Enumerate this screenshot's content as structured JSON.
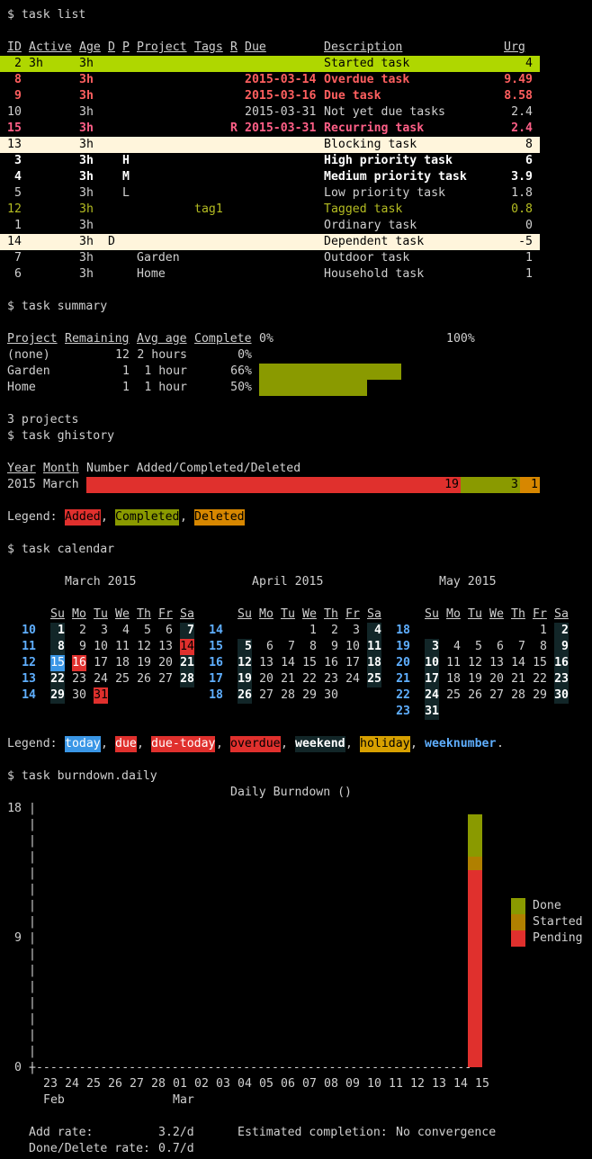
{
  "commands": {
    "list": "$ task list",
    "summary": "$ task summary",
    "ghistory": "$ task ghistory",
    "calendar": "$ task calendar",
    "burndown": "$ task burndown.daily"
  },
  "task_list": {
    "headers": [
      "ID",
      "Active",
      "Age",
      "D",
      "P",
      "Project",
      "Tags",
      "R",
      "Due",
      "Description",
      "Urg"
    ],
    "rows": [
      {
        "id": "2",
        "active": "3h",
        "age": "3h",
        "d": "",
        "p": "",
        "project": "",
        "tags": "",
        "r": "",
        "due": "",
        "desc": "Started task",
        "urg": "4",
        "style": "started"
      },
      {
        "id": "8",
        "active": "",
        "age": "3h",
        "d": "",
        "p": "",
        "project": "",
        "tags": "",
        "r": "",
        "due": "2015-03-14",
        "desc": "Overdue task",
        "urg": "9.49",
        "style": "overdue"
      },
      {
        "id": "9",
        "active": "",
        "age": "3h",
        "d": "",
        "p": "",
        "project": "",
        "tags": "",
        "r": "",
        "due": "2015-03-16",
        "desc": "Due task",
        "urg": "8.58",
        "style": "due"
      },
      {
        "id": "10",
        "active": "",
        "age": "3h",
        "d": "",
        "p": "",
        "project": "",
        "tags": "",
        "r": "",
        "due": "2015-03-31",
        "desc": "Not yet due tasks",
        "urg": "2.4",
        "style": "normal"
      },
      {
        "id": "15",
        "active": "",
        "age": "3h",
        "d": "",
        "p": "",
        "project": "",
        "tags": "",
        "r": "R",
        "due": "2015-03-31",
        "desc": "Recurring task",
        "urg": "2.4",
        "style": "recurring"
      },
      {
        "id": "13",
        "active": "",
        "age": "3h",
        "d": "",
        "p": "",
        "project": "",
        "tags": "",
        "r": "",
        "due": "",
        "desc": "Blocking task",
        "urg": "8",
        "style": "blocking"
      },
      {
        "id": "3",
        "active": "",
        "age": "3h",
        "d": "",
        "p": "H",
        "project": "",
        "tags": "",
        "r": "",
        "due": "",
        "desc": "High priority task",
        "urg": "6",
        "style": "high"
      },
      {
        "id": "4",
        "active": "",
        "age": "3h",
        "d": "",
        "p": "M",
        "project": "",
        "tags": "",
        "r": "",
        "due": "",
        "desc": "Medium priority task",
        "urg": "3.9",
        "style": "medium"
      },
      {
        "id": "5",
        "active": "",
        "age": "3h",
        "d": "",
        "p": "L",
        "project": "",
        "tags": "",
        "r": "",
        "due": "",
        "desc": "Low priority task",
        "urg": "1.8",
        "style": "normal"
      },
      {
        "id": "12",
        "active": "",
        "age": "3h",
        "d": "",
        "p": "",
        "project": "",
        "tags": "tag1",
        "r": "",
        "due": "",
        "desc": "Tagged task",
        "urg": "0.8",
        "style": "tagged"
      },
      {
        "id": "1",
        "active": "",
        "age": "3h",
        "d": "",
        "p": "",
        "project": "",
        "tags": "",
        "r": "",
        "due": "",
        "desc": "Ordinary task",
        "urg": "0",
        "style": "normal"
      },
      {
        "id": "14",
        "active": "",
        "age": "3h",
        "d": "D",
        "p": "",
        "project": "",
        "tags": "",
        "r": "",
        "due": "",
        "desc": "Dependent task",
        "urg": "-5",
        "style": "blocked"
      },
      {
        "id": "7",
        "active": "",
        "age": "3h",
        "d": "",
        "p": "",
        "project": "Garden",
        "tags": "",
        "r": "",
        "due": "",
        "desc": "Outdoor task",
        "urg": "1",
        "style": "normal"
      },
      {
        "id": "6",
        "active": "",
        "age": "3h",
        "d": "",
        "p": "",
        "project": "Home",
        "tags": "",
        "r": "",
        "due": "",
        "desc": "Household task",
        "urg": "1",
        "style": "normal"
      }
    ]
  },
  "summary": {
    "headers": {
      "project": "Project",
      "remaining": "Remaining",
      "avg_age": "Avg age",
      "complete": "Complete",
      "zero": "0%",
      "hundred": "100%"
    },
    "rows": [
      {
        "project": "(none)",
        "remaining": "12",
        "avg_age": "2 hours",
        "complete": "0%",
        "fraction": 0
      },
      {
        "project": "Garden",
        "remaining": "1",
        "avg_age": "1 hour",
        "complete": "66%",
        "fraction": 0.66
      },
      {
        "project": "Home",
        "remaining": "1",
        "avg_age": "1 hour",
        "complete": "50%",
        "fraction": 0.5
      }
    ],
    "footer": "3 projects"
  },
  "ghistory": {
    "headers": {
      "year": "Year",
      "month": "Month",
      "rest": "Number Added/Completed/Deleted"
    },
    "row": {
      "year": "2015",
      "month": "March",
      "added": 19,
      "completed": 3,
      "deleted": 1,
      "added_label": "19",
      "completed_label": "3",
      "deleted_label": "1"
    },
    "legend": {
      "prefix": "Legend: ",
      "added": "Added",
      "sep1": ", ",
      "completed": "Completed",
      "sep2": ", ",
      "deleted": "Deleted"
    },
    "colors": {
      "added": "#e0302d",
      "completed": "#8a9a00",
      "deleted": "#d78700"
    }
  },
  "calendar": {
    "day_headers": [
      "Su",
      "Mo",
      "Tu",
      "We",
      "Th",
      "Fr",
      "Sa"
    ],
    "months": [
      {
        "title": "March 2015",
        "weeks": [
          {
            "wn": "10",
            "days": [
              "1",
              "2",
              "3",
              "4",
              "5",
              "6",
              "7"
            ]
          },
          {
            "wn": "11",
            "days": [
              "8",
              "9",
              "10",
              "11",
              "12",
              "13",
              "14"
            ]
          },
          {
            "wn": "12",
            "days": [
              "15",
              "16",
              "17",
              "18",
              "19",
              "20",
              "21"
            ]
          },
          {
            "wn": "13",
            "days": [
              "22",
              "23",
              "24",
              "25",
              "26",
              "27",
              "28"
            ]
          },
          {
            "wn": "14",
            "days": [
              "29",
              "30",
              "31",
              "",
              "",
              "",
              ""
            ]
          }
        ]
      },
      {
        "title": "April 2015",
        "weeks": [
          {
            "wn": "14",
            "days": [
              "",
              "",
              "",
              "1",
              "2",
              "3",
              "4"
            ]
          },
          {
            "wn": "15",
            "days": [
              "5",
              "6",
              "7",
              "8",
              "9",
              "10",
              "11"
            ]
          },
          {
            "wn": "16",
            "days": [
              "12",
              "13",
              "14",
              "15",
              "16",
              "17",
              "18"
            ]
          },
          {
            "wn": "17",
            "days": [
              "19",
              "20",
              "21",
              "22",
              "23",
              "24",
              "25"
            ]
          },
          {
            "wn": "18",
            "days": [
              "26",
              "27",
              "28",
              "29",
              "30",
              "",
              ""
            ]
          }
        ]
      },
      {
        "title": "May 2015",
        "weeks": [
          {
            "wn": "18",
            "days": [
              "",
              "",
              "",
              "",
              "",
              "1",
              "2"
            ]
          },
          {
            "wn": "19",
            "days": [
              "3",
              "4",
              "5",
              "6",
              "7",
              "8",
              "9"
            ]
          },
          {
            "wn": "20",
            "days": [
              "10",
              "11",
              "12",
              "13",
              "14",
              "15",
              "16"
            ]
          },
          {
            "wn": "21",
            "days": [
              "17",
              "18",
              "19",
              "20",
              "21",
              "22",
              "23"
            ]
          },
          {
            "wn": "22",
            "days": [
              "24",
              "25",
              "26",
              "27",
              "28",
              "29",
              "30"
            ]
          },
          {
            "wn": "23",
            "days": [
              "31",
              "",
              "",
              "",
              "",
              "",
              ""
            ]
          }
        ]
      }
    ],
    "legend": {
      "prefix": "Legend: ",
      "today": "today",
      "due": "due",
      "due_today": "due-today",
      "overdue": "overdue",
      "weekend": "weekend",
      "holiday": "holiday",
      "weeknumber": "weeknumber",
      "sep": ", ",
      "end": "."
    }
  },
  "burndown": {
    "title": "Daily Burndown ()",
    "y_labels": [
      "18",
      "9",
      "0"
    ],
    "axis_line": "+-------------------------------------------------------------",
    "x_days": [
      "23",
      "24",
      "25",
      "26",
      "27",
      "28",
      "01",
      "02",
      "03",
      "04",
      "05",
      "06",
      "07",
      "08",
      "09",
      "10",
      "11",
      "12",
      "13",
      "14",
      "15"
    ],
    "month_labels": [
      "Feb",
      "Mar"
    ],
    "legend": [
      "Done",
      "Started",
      "Pending"
    ],
    "colors": {
      "done": "#8a9a00",
      "started": "#b08000",
      "pending": "#e0302d"
    },
    "chart_data": {
      "type": "bar",
      "categories": [
        "23",
        "24",
        "25",
        "26",
        "27",
        "28",
        "01",
        "02",
        "03",
        "04",
        "05",
        "06",
        "07",
        "08",
        "09",
        "10",
        "11",
        "12",
        "13",
        "14",
        "15"
      ],
      "series": [
        {
          "name": "Pending",
          "values": [
            0,
            0,
            0,
            0,
            0,
            0,
            0,
            0,
            0,
            0,
            0,
            0,
            0,
            0,
            0,
            0,
            0,
            0,
            0,
            0,
            14
          ]
        },
        {
          "name": "Started",
          "values": [
            0,
            0,
            0,
            0,
            0,
            0,
            0,
            0,
            0,
            0,
            0,
            0,
            0,
            0,
            0,
            0,
            0,
            0,
            0,
            0,
            1
          ]
        },
        {
          "name": "Done",
          "values": [
            0,
            0,
            0,
            0,
            0,
            0,
            0,
            0,
            0,
            0,
            0,
            0,
            0,
            0,
            0,
            0,
            0,
            0,
            0,
            0,
            3
          ]
        }
      ],
      "ylim": [
        0,
        18
      ]
    },
    "stats": {
      "add_rate_label": "Add rate:",
      "add_rate": "3.2/d",
      "done_rate_label": "Done/Delete rate:",
      "done_rate": "0.7/d",
      "est_label": "Estimated completion:",
      "est": "No convergence"
    }
  }
}
